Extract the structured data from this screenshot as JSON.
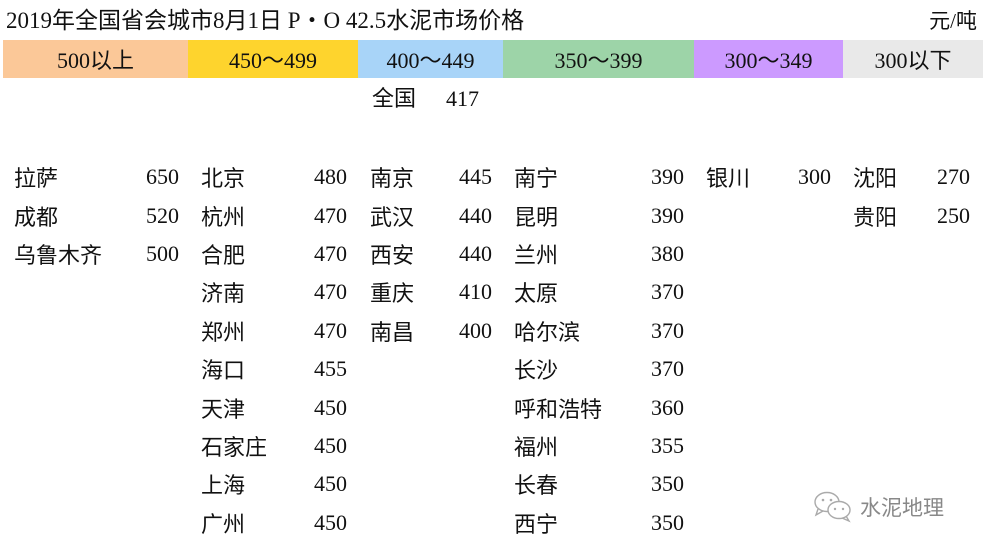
{
  "title": "2019年全国省会城市8月1日 P・O 42.5水泥市场价格",
  "unit": "元/吨",
  "bands": [
    {
      "label": "500以上",
      "color": "#fbc898"
    },
    {
      "label": "450～499",
      "color": "#fed42d"
    },
    {
      "label": "400～449",
      "color": "#a8d4f8"
    },
    {
      "label": "350～399",
      "color": "#9dd4a8"
    },
    {
      "label": "300～349",
      "color": "#cc9aff"
    },
    {
      "label": "300以下",
      "color": "#e9e9e9"
    }
  ],
  "national": {
    "label": "全国",
    "value": "417"
  },
  "columns": [
    [
      {
        "city": "拉萨",
        "price": "650"
      },
      {
        "city": "成都",
        "price": "520"
      },
      {
        "city": "乌鲁木齐",
        "price": "500"
      }
    ],
    [
      {
        "city": "北京",
        "price": "480"
      },
      {
        "city": "杭州",
        "price": "470"
      },
      {
        "city": "合肥",
        "price": "470"
      },
      {
        "city": "济南",
        "price": "470"
      },
      {
        "city": "郑州",
        "price": "470"
      },
      {
        "city": "海口",
        "price": "455"
      },
      {
        "city": "天津",
        "price": "450"
      },
      {
        "city": "石家庄",
        "price": "450"
      },
      {
        "city": "上海",
        "price": "450"
      },
      {
        "city": "广州",
        "price": "450"
      }
    ],
    [
      {
        "city": "南京",
        "price": "445"
      },
      {
        "city": "武汉",
        "price": "440"
      },
      {
        "city": "西安",
        "price": "440"
      },
      {
        "city": "重庆",
        "price": "410"
      },
      {
        "city": "南昌",
        "price": "400"
      }
    ],
    [
      {
        "city": "南宁",
        "price": "390"
      },
      {
        "city": "昆明",
        "price": "390"
      },
      {
        "city": "兰州",
        "price": "380"
      },
      {
        "city": "太原",
        "price": "370"
      },
      {
        "city": "哈尔滨",
        "price": "370"
      },
      {
        "city": "长沙",
        "price": "370"
      },
      {
        "city": "呼和浩特",
        "price": "360"
      },
      {
        "city": "福州",
        "price": "355"
      },
      {
        "city": "长春",
        "price": "350"
      },
      {
        "city": "西宁",
        "price": "350"
      }
    ],
    [
      {
        "city": "银川",
        "price": "300"
      }
    ],
    [
      {
        "city": "沈阳",
        "price": "270"
      },
      {
        "city": "贵阳",
        "price": "250"
      }
    ]
  ],
  "watermark": {
    "icon": "wechat-icon",
    "text": "水泥地理"
  }
}
